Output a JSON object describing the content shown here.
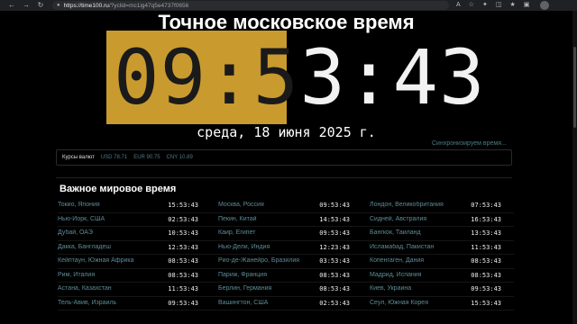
{
  "browser": {
    "url_host": "https://time100.ru",
    "url_path": "/?yclid=mc1ig47q5e4737f0656",
    "nav_icons": [
      "back-icon",
      "forward-icon",
      "reload-icon"
    ],
    "tool_icons": [
      "read-aloud-icon",
      "favorite-icon",
      "extensions-icon",
      "split-screen-icon",
      "favorites-bar-icon",
      "collections-icon"
    ]
  },
  "header": {
    "title": "Точное московское время"
  },
  "clock": {
    "hours": "09",
    "sep1": ":",
    "minutes_first": "5",
    "minutes_second": "3",
    "sep2": ":",
    "seconds": "43"
  },
  "date": "среда, 18 июня 2025 г.",
  "sync_label": "Синхронизируем время...",
  "rates": {
    "label": "Курсы валют",
    "usd": "USD 78.71",
    "eur": "EUR 90.75",
    "cny": "CNY 10.89"
  },
  "world": {
    "title": "Важное мировое время",
    "rows": [
      [
        {
          "city": "Токио, Япония",
          "time": "15:53:43"
        },
        {
          "city": "Москва, Россия",
          "time": "09:53:43"
        },
        {
          "city": "Лондон, Великобритания",
          "time": "07:53:43"
        }
      ],
      [
        {
          "city": "Нью-Йорк, США",
          "time": "02:53:43"
        },
        {
          "city": "Пекин, Китай",
          "time": "14:53:43"
        },
        {
          "city": "Сидней, Австралия",
          "time": "16:53:43"
        }
      ],
      [
        {
          "city": "Дубай, ОАЭ",
          "time": "10:53:43"
        },
        {
          "city": "Каир, Египет",
          "time": "09:53:43"
        },
        {
          "city": "Бангкок, Таиланд",
          "time": "13:53:43"
        }
      ],
      [
        {
          "city": "Дакка, Бангладеш",
          "time": "12:53:43"
        },
        {
          "city": "Нью-Дели, Индия",
          "time": "12:23:43"
        },
        {
          "city": "Исламабад, Пакистан",
          "time": "11:53:43"
        }
      ],
      [
        {
          "city": "Кейптаун, Южная Африка",
          "time": "08:53:43"
        },
        {
          "city": "Рио-де-Жанейро, Бразилия",
          "time": "03:53:43"
        },
        {
          "city": "Копенгаген, Дания",
          "time": "08:53:43"
        }
      ],
      [
        {
          "city": "Рим, Италия",
          "time": "08:53:43"
        },
        {
          "city": "Париж, Франция",
          "time": "08:53:43"
        },
        {
          "city": "Мадрид, Испания",
          "time": "08:53:43"
        }
      ],
      [
        {
          "city": "Астана, Казахстан",
          "time": "11:53:43"
        },
        {
          "city": "Берлин, Германия",
          "time": "08:53:43"
        },
        {
          "city": "Киев, Украина",
          "time": "09:53:43"
        }
      ],
      [
        {
          "city": "Тель-Авив, Израиль",
          "time": "09:53:43"
        },
        {
          "city": "Вашингтон, США",
          "time": "02:53:43"
        },
        {
          "city": "Сеул, Южная Корея",
          "time": "15:53:43"
        }
      ]
    ]
  },
  "colors": {
    "accent": "#c99a2e",
    "link": "#5b8c97",
    "background": "#000000"
  }
}
